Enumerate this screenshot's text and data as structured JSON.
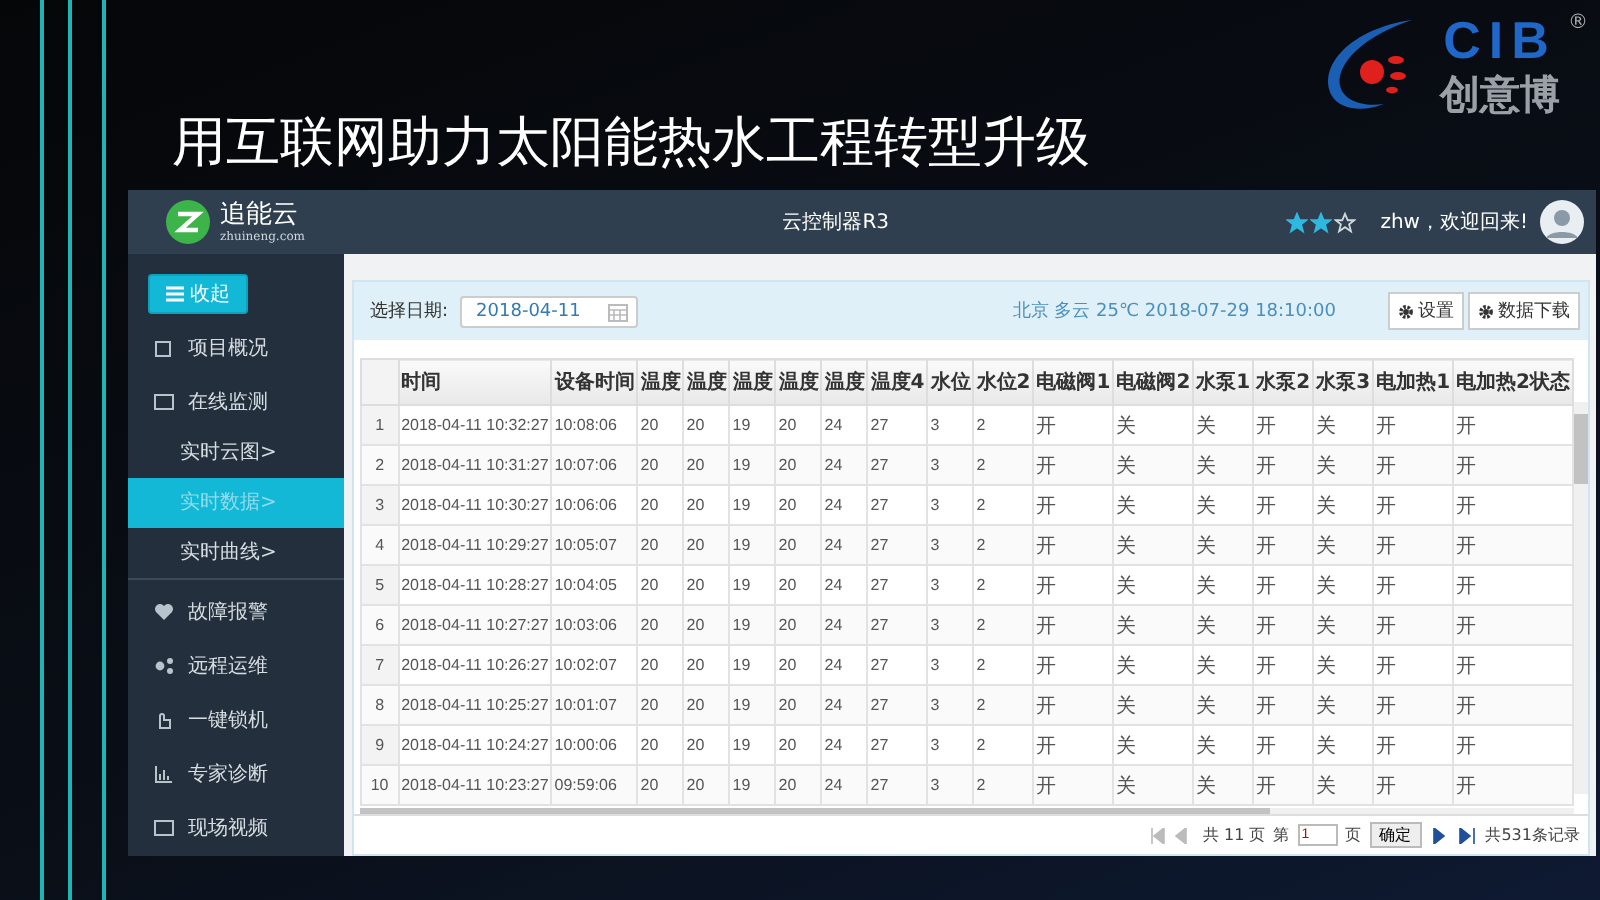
{
  "slide_title": "用互联网助力太阳能热水工程转型升级",
  "brand_logo": {
    "letters": "CIB",
    "name": "创意博",
    "mark": "®"
  },
  "app": {
    "logo": {
      "name": "追能云",
      "domain": "zhuineng.com"
    },
    "title": "云控制器R3",
    "greeting": "zhw，欢迎回来!"
  },
  "sidebar": {
    "collapse_button": "收起",
    "items": [
      {
        "label": "项目概况"
      },
      {
        "label": "在线监测",
        "children": [
          {
            "label": "实时云图>",
            "selected": false
          },
          {
            "label": "实时数据>",
            "selected": true
          },
          {
            "label": "实时曲线>",
            "selected": false
          }
        ]
      },
      {
        "label": "故障报警"
      },
      {
        "label": "远程运维"
      },
      {
        "label": "一键锁机"
      },
      {
        "label": "专家诊断"
      },
      {
        "label": "现场视频"
      }
    ]
  },
  "toolbar": {
    "date_label": "选择日期:",
    "date_value": "2018-04-11",
    "weather": "北京 多云 25℃ 2018-07-29 18:10:00",
    "buttons": [
      "设置",
      "数据下载"
    ]
  },
  "table": {
    "columns": [
      "",
      "时间",
      "设备时间",
      "温度",
      "温度",
      "温度",
      "温度",
      "温度",
      "温度4",
      "水位",
      "水位2",
      "电磁阀1",
      "电磁阀2",
      "水泵1",
      "水泵2",
      "水泵3",
      "电加热1",
      "电加热2状态"
    ],
    "rows": [
      [
        "1",
        "2018-04-11 10:32:27",
        "10:08:06",
        "20",
        "20",
        "19",
        "20",
        "24",
        "27",
        "3",
        "2",
        "开",
        "关",
        "关",
        "开",
        "关",
        "开",
        "开"
      ],
      [
        "2",
        "2018-04-11 10:31:27",
        "10:07:06",
        "20",
        "20",
        "19",
        "20",
        "24",
        "27",
        "3",
        "2",
        "开",
        "关",
        "关",
        "开",
        "关",
        "开",
        "开"
      ],
      [
        "3",
        "2018-04-11 10:30:27",
        "10:06:06",
        "20",
        "20",
        "19",
        "20",
        "24",
        "27",
        "3",
        "2",
        "开",
        "关",
        "关",
        "开",
        "关",
        "开",
        "开"
      ],
      [
        "4",
        "2018-04-11 10:29:27",
        "10:05:07",
        "20",
        "20",
        "19",
        "20",
        "24",
        "27",
        "3",
        "2",
        "开",
        "关",
        "关",
        "开",
        "关",
        "开",
        "开"
      ],
      [
        "5",
        "2018-04-11 10:28:27",
        "10:04:05",
        "20",
        "20",
        "19",
        "20",
        "24",
        "27",
        "3",
        "2",
        "开",
        "关",
        "关",
        "开",
        "关",
        "开",
        "开"
      ],
      [
        "6",
        "2018-04-11 10:27:27",
        "10:03:06",
        "20",
        "20",
        "19",
        "20",
        "24",
        "27",
        "3",
        "2",
        "开",
        "关",
        "关",
        "开",
        "关",
        "开",
        "开"
      ],
      [
        "7",
        "2018-04-11 10:26:27",
        "10:02:07",
        "20",
        "20",
        "19",
        "20",
        "24",
        "27",
        "3",
        "2",
        "开",
        "关",
        "关",
        "开",
        "关",
        "开",
        "开"
      ],
      [
        "8",
        "2018-04-11 10:25:27",
        "10:01:07",
        "20",
        "20",
        "19",
        "20",
        "24",
        "27",
        "3",
        "2",
        "开",
        "关",
        "关",
        "开",
        "关",
        "开",
        "开"
      ],
      [
        "9",
        "2018-04-11 10:24:27",
        "10:00:06",
        "20",
        "20",
        "19",
        "20",
        "24",
        "27",
        "3",
        "2",
        "开",
        "关",
        "关",
        "开",
        "关",
        "开",
        "开"
      ],
      [
        "10",
        "2018-04-11 10:23:27",
        "09:59:06",
        "20",
        "20",
        "19",
        "20",
        "24",
        "27",
        "3",
        "2",
        "开",
        "关",
        "关",
        "开",
        "关",
        "开",
        "开"
      ]
    ]
  },
  "pager": {
    "total_pages": "共 11 页",
    "page_prefix": "第",
    "page_value": "1",
    "page_suffix": "页",
    "confirm": "确定",
    "records": "共531条记录"
  }
}
